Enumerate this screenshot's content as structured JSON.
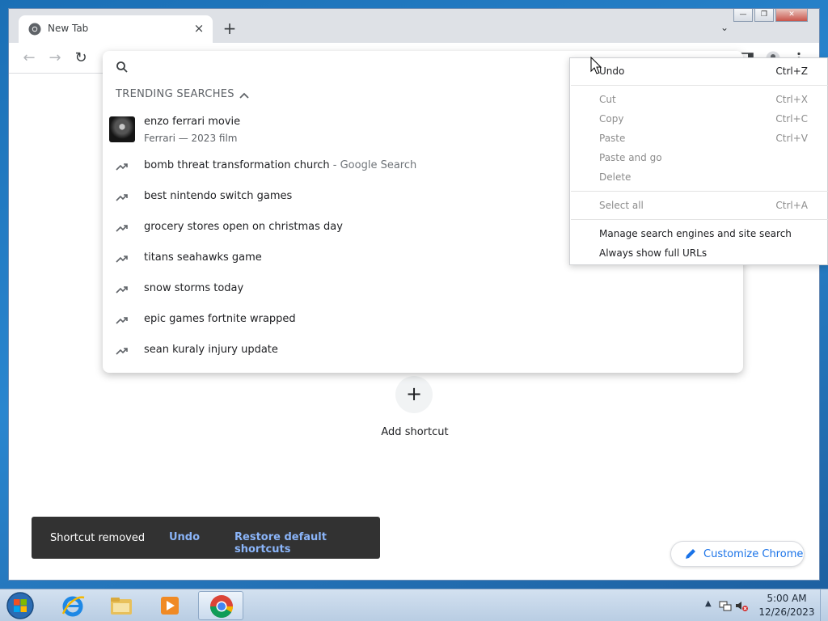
{
  "browser": {
    "tab_title": "New Tab",
    "tab_close_icon": "×",
    "new_tab_icon": "+",
    "tab_search_icon": "⌄",
    "back_icon": "←",
    "forward_icon": "→",
    "reload_icon": "↻",
    "window_controls": {
      "minimize": "—",
      "maximize": "❐",
      "close": "✕"
    }
  },
  "omnibox": {
    "input_value": "",
    "trending_header": "TRENDING SEARCHES",
    "entity": {
      "title": "enzo ferrari movie",
      "subtitle": "Ferrari — 2023 film"
    },
    "suggestions": [
      {
        "text": "bomb threat transformation church",
        "suffix": " - Google Search"
      },
      {
        "text": "best nintendo switch games",
        "suffix": ""
      },
      {
        "text": "grocery stores open on christmas day",
        "suffix": ""
      },
      {
        "text": "titans seahawks game",
        "suffix": ""
      },
      {
        "text": "snow storms today",
        "suffix": ""
      },
      {
        "text": "epic games fortnite wrapped",
        "suffix": ""
      },
      {
        "text": "sean kuraly injury update",
        "suffix": ""
      }
    ]
  },
  "context_menu": {
    "undo": {
      "label": "Undo",
      "shortcut": "Ctrl+Z"
    },
    "cut": {
      "label": "Cut",
      "shortcut": "Ctrl+X"
    },
    "copy": {
      "label": "Copy",
      "shortcut": "Ctrl+C"
    },
    "paste": {
      "label": "Paste",
      "shortcut": "Ctrl+V"
    },
    "paste_and_go": {
      "label": "Paste and go"
    },
    "delete": {
      "label": "Delete"
    },
    "select_all": {
      "label": "Select all",
      "shortcut": "Ctrl+A"
    },
    "manage_search": {
      "label": "Manage search engines and site search"
    },
    "show_full_urls": {
      "label": "Always show full URLs"
    }
  },
  "new_tab_page": {
    "add_shortcut_icon": "+",
    "add_shortcut_label": "Add shortcut",
    "toast": {
      "message": "Shortcut removed",
      "undo": "Undo",
      "restore": "Restore default shortcuts"
    },
    "customize_label": "Customize Chrome"
  },
  "taskbar": {
    "tray_expand_icon": "▲",
    "clock_time": "5:00 AM",
    "clock_date": "12/26/2023"
  },
  "colors": {
    "accent": "#1a73e8",
    "toast_link": "#8ab4f8",
    "toast_bg": "#323232",
    "desktop": "#2a86cf"
  }
}
